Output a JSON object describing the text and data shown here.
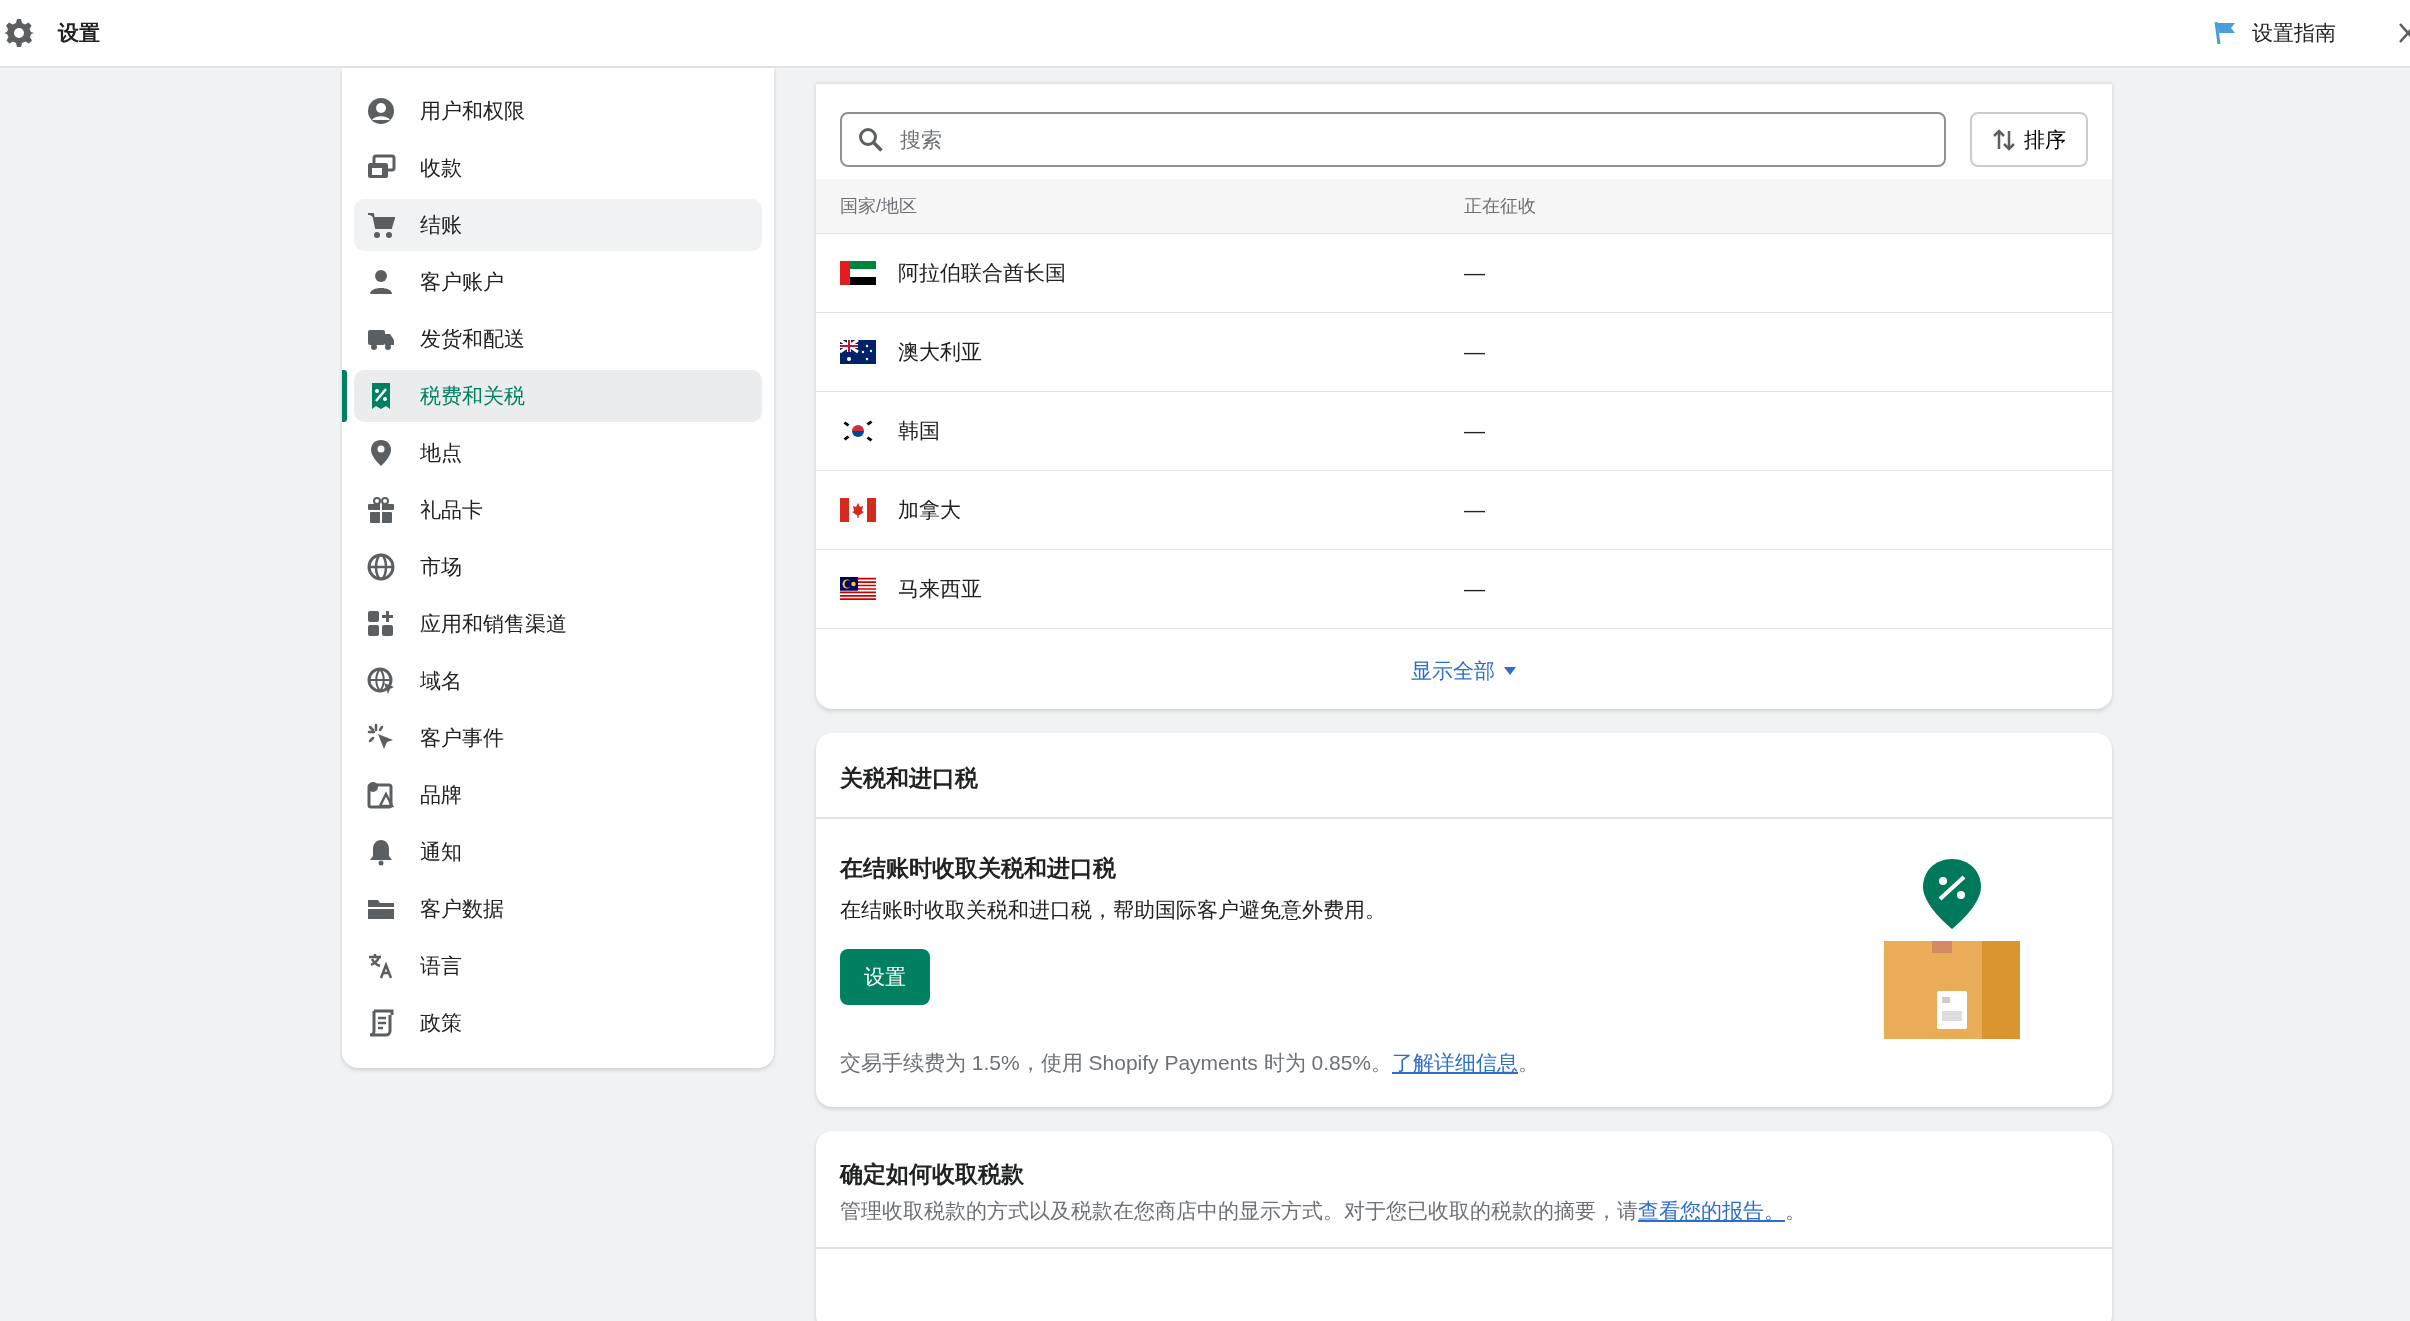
{
  "topbar": {
    "title": "设置",
    "guide_link": "设置指南"
  },
  "sidebar": {
    "items": [
      {
        "label": "用户和权限",
        "selected": false,
        "hovered": false
      },
      {
        "label": "收款",
        "selected": false,
        "hovered": false
      },
      {
        "label": "结账",
        "selected": false,
        "hovered": true
      },
      {
        "label": "客户账户",
        "selected": false,
        "hovered": false
      },
      {
        "label": "发货和配送",
        "selected": false,
        "hovered": false
      },
      {
        "label": "税费和关税",
        "selected": true,
        "hovered": false
      },
      {
        "label": "地点",
        "selected": false,
        "hovered": false
      },
      {
        "label": "礼品卡",
        "selected": false,
        "hovered": false
      },
      {
        "label": "市场",
        "selected": false,
        "hovered": false
      },
      {
        "label": "应用和销售渠道",
        "selected": false,
        "hovered": false
      },
      {
        "label": "域名",
        "selected": false,
        "hovered": false
      },
      {
        "label": "客户事件",
        "selected": false,
        "hovered": false
      },
      {
        "label": "品牌",
        "selected": false,
        "hovered": false
      },
      {
        "label": "通知",
        "selected": false,
        "hovered": false
      },
      {
        "label": "客户数据",
        "selected": false,
        "hovered": false
      },
      {
        "label": "语言",
        "selected": false,
        "hovered": false
      },
      {
        "label": "政策",
        "selected": false,
        "hovered": false
      }
    ]
  },
  "regions": {
    "search": {
      "placeholder": "搜索"
    },
    "sort_button": "排序",
    "columns": [
      "国家/地区",
      "正在征收"
    ],
    "rows": [
      {
        "country": "阿拉伯联合酋长国",
        "collecting": "—"
      },
      {
        "country": "澳大利亚",
        "collecting": "—"
      },
      {
        "country": "韩国",
        "collecting": "—"
      },
      {
        "country": "加拿大",
        "collecting": "—"
      },
      {
        "country": "马来西亚",
        "collecting": "—"
      }
    ],
    "show_all": "显示全部"
  },
  "duties": {
    "title": "关税和进口税",
    "heading": "在结账时收取关税和进口税",
    "description": "在结账时收取关税和进口税，帮助国际客户避免意外费用。",
    "button": "设置",
    "fee_note": "交易手续费为 1.5%，使用 Shopify Payments 时为 0.85%。",
    "fee_link": "了解详细信息",
    "fee_end": "。"
  },
  "collection": {
    "title": "确定如何收取税款",
    "description": "管理收取税款的方式以及税款在您商店中的显示方式。对于您已收取的税款的摘要，请",
    "link": "查看您的报告。",
    "end": "。"
  }
}
